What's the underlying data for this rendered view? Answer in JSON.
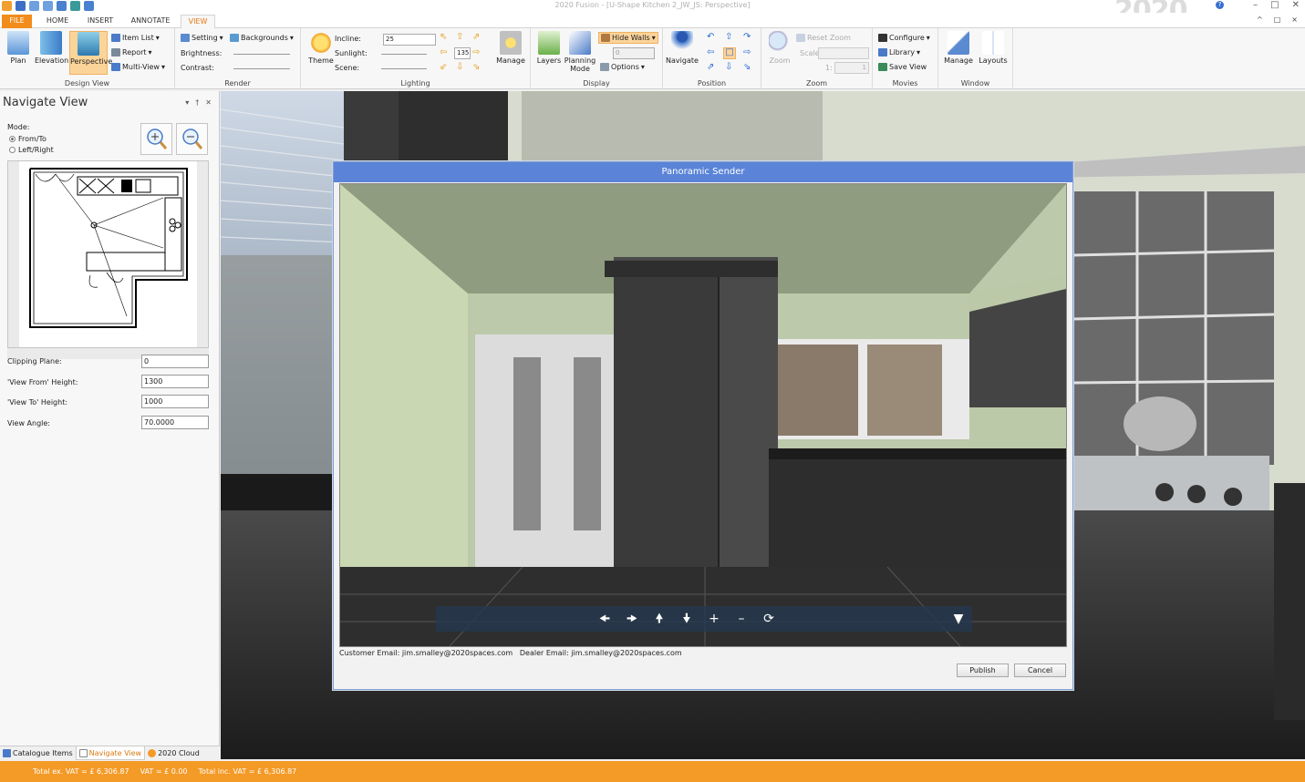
{
  "window": {
    "title": "2020 Fusion - [U-Shape Kitchen 2_JW_JS: Perspective]",
    "brand": "2020",
    "help": "?"
  },
  "tabs": [
    {
      "label": "FILE"
    },
    {
      "label": "HOME"
    },
    {
      "label": "INSERT"
    },
    {
      "label": "ANNOTATE"
    },
    {
      "label": "VIEW"
    }
  ],
  "ribbon_controls": {
    "up": "^",
    "restore": "□",
    "close": "×"
  },
  "design_view": {
    "plan": "Plan",
    "elevation": "Elevation",
    "perspective": "Perspective",
    "item_list": "Item List",
    "report": "Report",
    "multi_view": "Multi-View",
    "group": "Design View"
  },
  "render": {
    "setting": "Setting",
    "backgrounds": "Backgrounds",
    "brightness": "Brightness:",
    "contrast": "Contrast:",
    "theme": "Theme",
    "group": "Render"
  },
  "lighting": {
    "incline_label": "Incline:",
    "incline_value": "25",
    "sunlight_label": "Sunlight:",
    "scene_label": "Scene:",
    "angle_value": "135",
    "manage": "Manage",
    "group": "Lighting"
  },
  "display": {
    "layers": "Layers",
    "planning_mode": "Planning Mode",
    "hide_walls": "Hide Walls",
    "spin_value": "0",
    "options": "Options",
    "group": "Display"
  },
  "position": {
    "navigate": "Navigate",
    "group": "Position"
  },
  "zoom": {
    "zoom": "Zoom",
    "reset_zoom": "Reset Zoom",
    "scale": "Scale:",
    "ratio": "1:",
    "ratio_value": "1",
    "group": "Zoom"
  },
  "movies": {
    "configure": "Configure",
    "library": "Library",
    "save_view": "Save View",
    "group": "Movies"
  },
  "window_group": {
    "manage": "Manage",
    "layouts": "Layouts",
    "group": "Window"
  },
  "navigate_view": {
    "title": "Navigate View",
    "mode_label": "Mode:",
    "mode_options": [
      "From/To",
      "Left/Right"
    ],
    "clipping_plane_label": "Clipping Plane:",
    "clipping_plane": "0",
    "view_from_label": "'View From' Height:",
    "view_from": "1300",
    "view_to_label": "'View To' Height:",
    "view_to": "1000",
    "view_angle_label": "View Angle:",
    "view_angle": "70.0000"
  },
  "pane_tabs": [
    {
      "label": "Catalogue Items"
    },
    {
      "label": "Navigate View"
    },
    {
      "label": "2020 Cloud"
    }
  ],
  "dialog": {
    "title": "Panoramic Sender",
    "customer_email": "Customer Email: jim.smalley@2020spaces.com",
    "dealer_email": "Dealer Email: jim.smalley@2020spaces.com",
    "publish": "Publish",
    "cancel": "Cancel"
  },
  "status": {
    "total_ex": "Total ex. VAT = £ 6,306.87",
    "vat": "VAT = £ 0.00",
    "total_inc": "Total inc. VAT = £ 6,306.87"
  },
  "colors": {
    "accent": "#f49a26",
    "dialog_title": "#5b84d8"
  }
}
